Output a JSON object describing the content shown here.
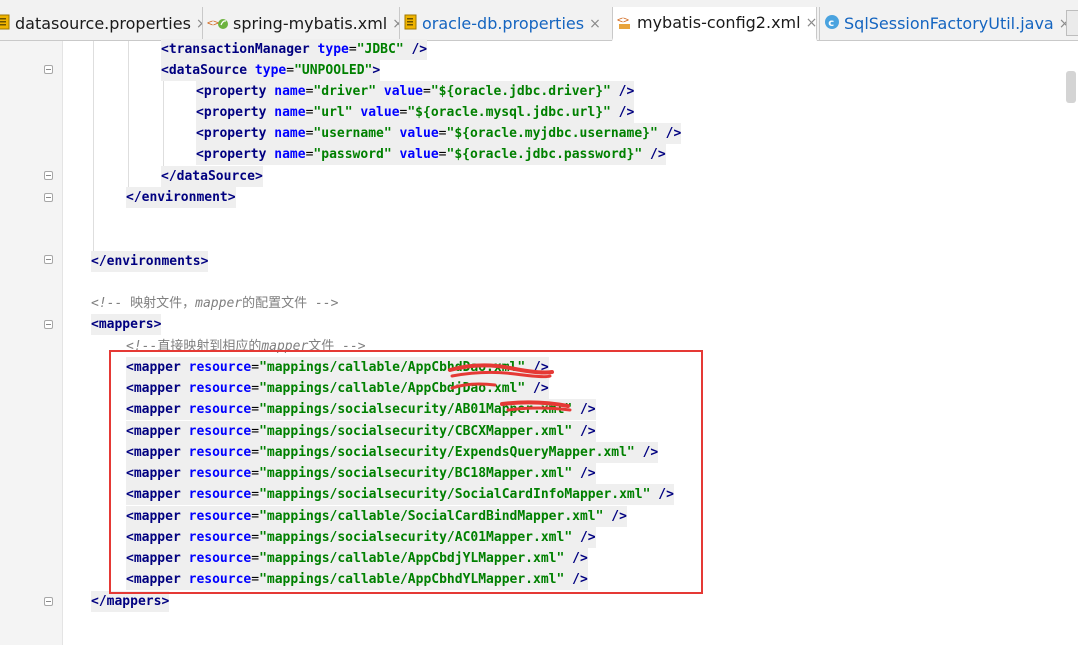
{
  "tabs": [
    {
      "label": "datasource.properties",
      "icon": "properties-file-icon",
      "active": false
    },
    {
      "label": "spring-mybatis.xml",
      "icon": "spring-xml-icon",
      "active": false
    },
    {
      "label": "oracle-db.properties",
      "icon": "properties-file-icon",
      "active": false
    },
    {
      "label": "mybatis-config2.xml",
      "icon": "xml-file-icon",
      "active": true
    },
    {
      "label": "SqlSessionFactoryUtil.java",
      "icon": "java-class-icon",
      "active": false
    }
  ],
  "close_glyph": "×",
  "code": {
    "l1": {
      "o": "<",
      "tag": "transactionManager",
      "a1": " type",
      "eq": "=",
      "v1": "\"JDBC\"",
      "end": " />"
    },
    "l2": {
      "o": "<",
      "tag": "dataSource",
      "a1": " type",
      "eq": "=",
      "v1": "\"UNPOOLED\"",
      "end": ">"
    },
    "l3": {
      "o": "<",
      "tag": "property",
      "a1": " name",
      "eq": "=",
      "v1": "\"driver\"",
      "a2": " value",
      "v2": "\"${oracle.jdbc.driver}\"",
      "end": " />"
    },
    "l4": {
      "o": "<",
      "tag": "property",
      "a1": " name",
      "eq": "=",
      "v1": "\"url\"",
      "a2": " value",
      "v2": "\"${oracle.mysql.jdbc.url}\"",
      "end": " />"
    },
    "l5": {
      "o": "<",
      "tag": "property",
      "a1": " name",
      "eq": "=",
      "v1": "\"username\"",
      "a2": " value",
      "v2": "\"${oracle.myjdbc.username}\"",
      "end": " />"
    },
    "l6": {
      "o": "<",
      "tag": "property",
      "a1": " name",
      "eq": "=",
      "v1": "\"password\"",
      "a2": " value",
      "v2": "\"${oracle.jdbc.password}\"",
      "end": " />"
    },
    "l7": {
      "o": "</",
      "tag": "dataSource",
      "end": ">"
    },
    "l8": {
      "o": "</",
      "tag": "environment",
      "end": ">"
    },
    "l9": {
      "o": "</",
      "tag": "environments",
      "end": ">"
    },
    "l10": {
      "c1": "<!-- ",
      "z": "映射文件，",
      "c2": "mapper",
      "z2": "的配置文件",
      "c3": " -->"
    },
    "l11": {
      "o": "<",
      "tag": "mappers",
      "end": ">"
    },
    "l12": {
      "c1": "<!--",
      "z": "直接映射到相应的",
      "c2": "mapper",
      "z2": "文件",
      "c3": " -->"
    },
    "mapper_tag": "mapper",
    "mapper_attr": " resource",
    "mapper_lines": [
      "\"mappings/callable/AppCbhdDao.xml\"",
      "\"mappings/callable/AppCbdjDao.xml\"",
      "\"mappings/socialsecurity/AB01Mapper.xml\"",
      "\"mappings/socialsecurity/CBCXMapper.xml\"",
      "\"mappings/socialsecurity/ExpendsQueryMapper.xml\"",
      "\"mappings/socialsecurity/BC18Mapper.xml\"",
      "\"mappings/socialsecurity/SocialCardInfoMapper.xml\"",
      "\"mappings/callable/SocialCardBindMapper.xml\"",
      "\"mappings/socialsecurity/AC01Mapper.xml\"",
      "\"mappings/callable/AppCbdjYLMapper.xml\"",
      "\"mappings/callable/AppCbhdYLMapper.xml\""
    ],
    "l24": {
      "o": "</",
      "tag": "mappers",
      "end": ">"
    }
  },
  "colors": {
    "tag": "#000080",
    "attr": "#0000ff",
    "value": "#008000",
    "comment": "#808080",
    "annotation": "#e53935"
  }
}
